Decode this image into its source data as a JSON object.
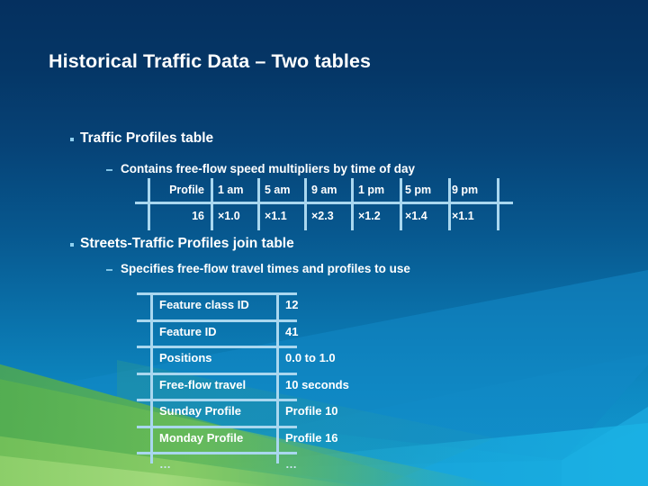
{
  "slide": {
    "title": "Historical Traffic Data – Two tables",
    "accent_color": "#a9d7ef",
    "background_top_color": "#05305f",
    "background_bottom_color": "#1599cf"
  },
  "sections": [
    {
      "bullet": "Traffic Profiles table",
      "sub_bullet": "Contains free-flow speed multipliers by time of day"
    },
    {
      "bullet": "Streets-Traffic Profiles join table",
      "sub_bullet": "Specifies free-flow travel times and profiles to use"
    }
  ],
  "profiles_table": {
    "headers": [
      "Profile",
      "1 am",
      "5 am",
      "9 am",
      "1 pm",
      "5 pm",
      "9 pm"
    ],
    "row": [
      "16",
      "×1.0",
      "×1.1",
      "×2.3",
      "×1.2",
      "×1.4",
      "×1.1"
    ]
  },
  "join_table": {
    "rows": [
      {
        "key": "Feature class ID",
        "value": "12"
      },
      {
        "key": "Feature ID",
        "value": "41"
      },
      {
        "key": "Positions",
        "value": "0.0 to 1.0"
      },
      {
        "key": "Free-flow travel",
        "value": "10 seconds"
      },
      {
        "key": "Sunday Profile",
        "value": "Profile 10"
      },
      {
        "key": "Monday Profile",
        "value": "Profile 16"
      },
      {
        "key": "…",
        "value": "…"
      }
    ]
  }
}
